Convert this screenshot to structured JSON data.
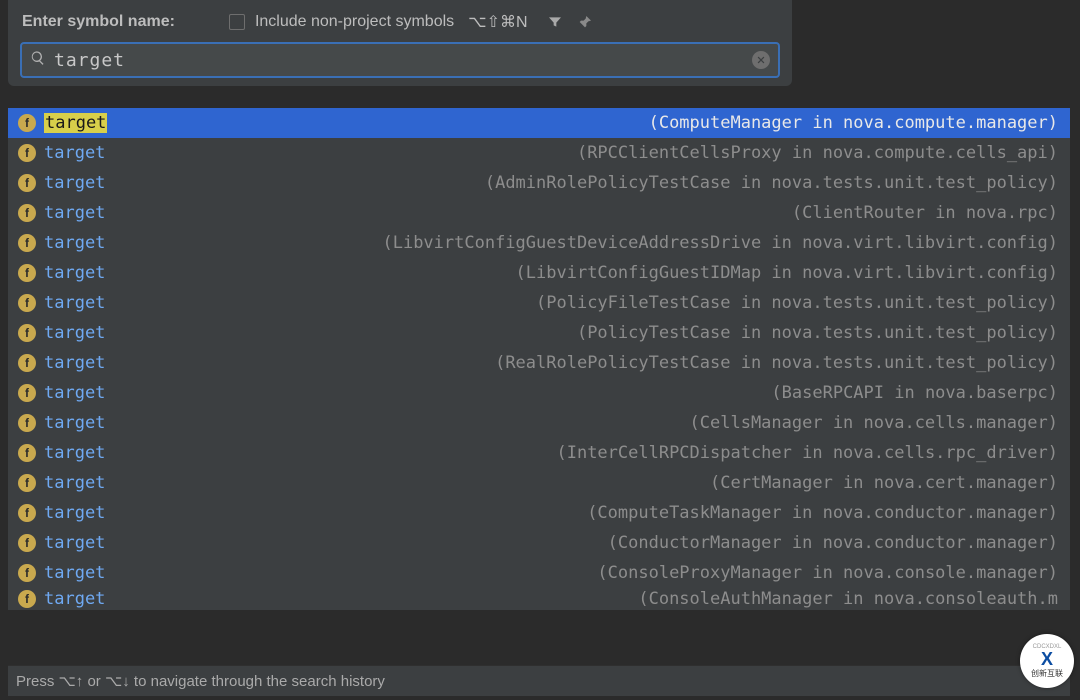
{
  "header": {
    "prompt": "Enter symbol name:",
    "checkbox_label": "Include non-project symbols",
    "shortcut": "⌥⇧⌘N"
  },
  "search": {
    "value": "target"
  },
  "badge_letter": "f",
  "results": [
    {
      "name": "target",
      "location": "(ComputeManager in nova.compute.manager)",
      "selected": true
    },
    {
      "name": "target",
      "location": "(RPCClientCellsProxy in nova.compute.cells_api)"
    },
    {
      "name": "target",
      "location": "(AdminRolePolicyTestCase in nova.tests.unit.test_policy)"
    },
    {
      "name": "target",
      "location": "(ClientRouter in nova.rpc)"
    },
    {
      "name": "target",
      "location": "(LibvirtConfigGuestDeviceAddressDrive in nova.virt.libvirt.config)"
    },
    {
      "name": "target",
      "location": "(LibvirtConfigGuestIDMap in nova.virt.libvirt.config)"
    },
    {
      "name": "target",
      "location": "(PolicyFileTestCase in nova.tests.unit.test_policy)"
    },
    {
      "name": "target",
      "location": "(PolicyTestCase in nova.tests.unit.test_policy)"
    },
    {
      "name": "target",
      "location": "(RealRolePolicyTestCase in nova.tests.unit.test_policy)"
    },
    {
      "name": "target",
      "location": "(BaseRPCAPI in nova.baserpc)"
    },
    {
      "name": "target",
      "location": "(CellsManager in nova.cells.manager)"
    },
    {
      "name": "target",
      "location": "(InterCellRPCDispatcher in nova.cells.rpc_driver)"
    },
    {
      "name": "target",
      "location": "(CertManager in nova.cert.manager)"
    },
    {
      "name": "target",
      "location": "(ComputeTaskManager in nova.conductor.manager)"
    },
    {
      "name": "target",
      "location": "(ConductorManager in nova.conductor.manager)"
    },
    {
      "name": "target",
      "location": "(ConsoleProxyManager in nova.console.manager)"
    },
    {
      "name": "target",
      "location": "(ConsoleAuthManager in nova.consoleauth.m",
      "truncated": true
    }
  ],
  "footer": {
    "hint": "Press ⌥↑ or ⌥↓ to navigate through the search history"
  },
  "watermark": {
    "top": "CDCXDXL",
    "mid": "X",
    "bot": "创新互联"
  }
}
